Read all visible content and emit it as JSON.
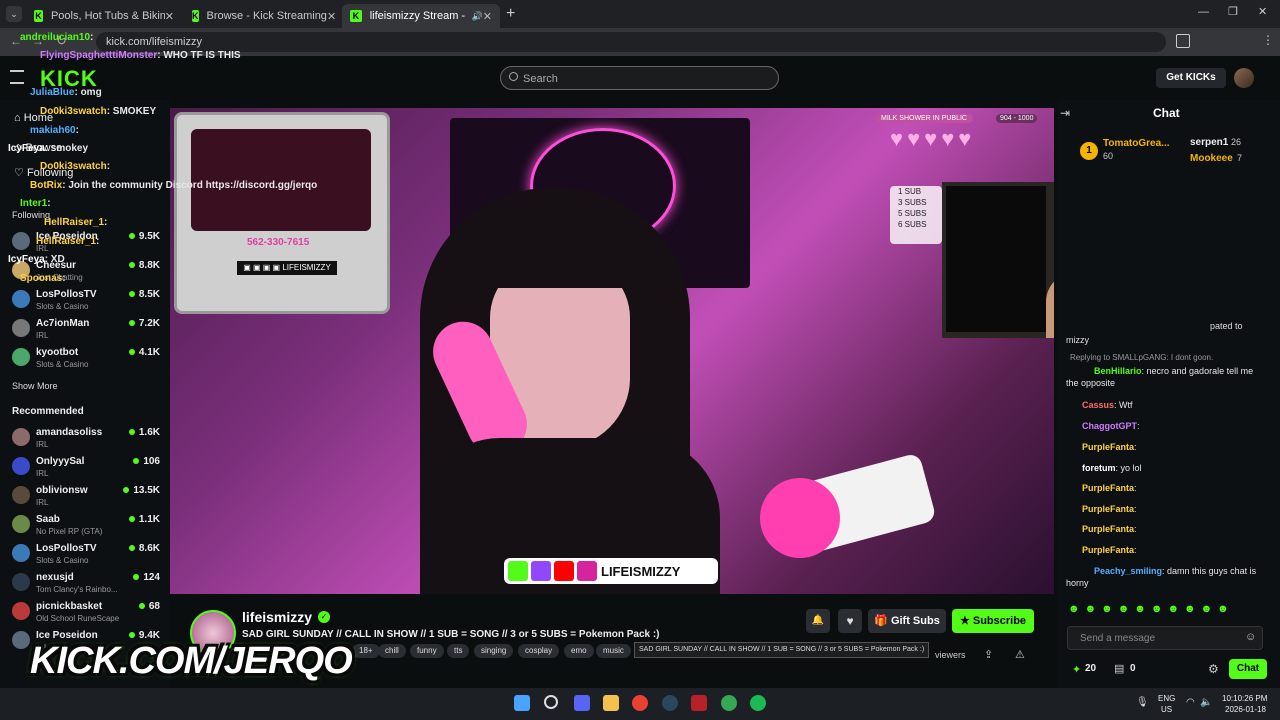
{
  "browser": {
    "tabs": [
      {
        "title": "Pools, Hot Tubs & Bikinis Strea",
        "active": false
      },
      {
        "title": "Browse - Kick Streaming",
        "active": false
      },
      {
        "title": "lifeismizzy Stream - Watch",
        "active": true
      }
    ],
    "new_tab": "+",
    "url": "kick.com/lifeismizzy",
    "window_controls": [
      "—",
      "❐",
      "✕"
    ]
  },
  "header": {
    "search_placeholder": "Search",
    "get_kicks_label": "Get KICKs"
  },
  "sidebar": {
    "nav": [
      {
        "label": "Home"
      },
      {
        "label": "Browse"
      },
      {
        "label": "Following"
      }
    ],
    "following_heading": "Following",
    "following": [
      {
        "name": "Ice Poseidon",
        "category": "IRL",
        "viewers": "9.5K"
      },
      {
        "name": "Cheesur",
        "category": "Just Chatting",
        "viewers": "8.8K"
      },
      {
        "name": "LosPollosTV",
        "category": "Slots & Casino",
        "viewers": "8.5K"
      },
      {
        "name": "Ac7ionMan",
        "category": "IRL",
        "viewers": "7.2K"
      },
      {
        "name": "kyootbot",
        "category": "Slots & Casino",
        "viewers": "4.1K"
      }
    ],
    "show_more": "Show More",
    "recommended_heading": "Recommended",
    "recommended": [
      {
        "name": "amandasoliss",
        "category": "IRL",
        "viewers": "1.6K"
      },
      {
        "name": "OnlyyySal",
        "category": "IRL",
        "viewers": "106"
      },
      {
        "name": "oblivionsw",
        "category": "IRL",
        "viewers": "13.5K"
      },
      {
        "name": "Saab",
        "category": "No Pixel RP (GTA)",
        "viewers": "1.1K"
      },
      {
        "name": "LosPollosTV",
        "category": "Slots & Casino",
        "viewers": "8.6K"
      },
      {
        "name": "nexusjd",
        "category": "Tom Clancy's Rainbo...",
        "viewers": "124"
      },
      {
        "name": "picnickbasket",
        "category": "Old School RuneScape",
        "viewers": "68"
      },
      {
        "name": "Ice Poseidon",
        "category": "IRL",
        "viewers": "9.4K"
      }
    ]
  },
  "overlay_chat": [
    {
      "user": "andreilucian10",
      "text": ":",
      "color": "#53fc18"
    },
    {
      "user": "FlyingSpaghetttiMonster",
      "text": ": WHO TF IS THIS",
      "color": "#d07cff"
    },
    {
      "user": "JuliaBlue",
      "text": ": omg",
      "color": "#53b0ff"
    },
    {
      "user": "Do0ki3swatch",
      "text": ": SMOKEY",
      "color": "#ffd23f"
    },
    {
      "user": "makiah60",
      "text": ":",
      "color": "#53b0ff"
    },
    {
      "user": "IcyFeya",
      "text": ": smokey",
      "color": "#ffffff"
    },
    {
      "user": "Do0ki3swatch",
      "text": ":",
      "color": "#ffd23f"
    },
    {
      "user": "BotRix",
      "text": ": Join the community Discord https://discord.gg/jerqo",
      "color": "#ffd23f"
    },
    {
      "user": "Inter1",
      "text": ":",
      "color": "#53fc18"
    },
    {
      "user": "HellRaiser_1",
      "text": ":",
      "color": "#ffd23f"
    },
    {
      "user": "HellRaiser_1",
      "text": ":",
      "color": "#ffd23f"
    },
    {
      "user": "IcyFeya",
      "text": ": XD",
      "color": "#ffffff"
    },
    {
      "user": "Spoonas",
      "text": ":",
      "color": "#ffd23f"
    }
  ],
  "stream": {
    "overlay_handle": "LIFEISMIZZY",
    "overlay_phone": "562-330-7615",
    "milk_shower_label": "MILK SHOWER IN PUBLIC",
    "milk_counter": "904 - 1000",
    "subs_list": [
      "1 SUB",
      "3 SUBS",
      "5 SUBS",
      "6 SUBS"
    ]
  },
  "channel": {
    "name": "lifeismizzy",
    "title": "SAD GIRL SUNDAY // CALL IN SHOW // 1 SUB = SONG // 3 or 5 SUBS = Pokemon Pack :)",
    "tooltip": "SAD GIRL SUNDAY // CALL IN SHOW // 1 SUB = SONG // 3 or 5 SUBS = Pokemon Pack :)",
    "tags": [
      "18+",
      "chill",
      "funny",
      "tts",
      "singing",
      "cosplay",
      "emo",
      "music"
    ],
    "gift_subs_label": "Gift Subs",
    "subscribe_label": "Subscribe",
    "viewers_label": "viewers"
  },
  "watermark": "KICK.COM/JERQO",
  "chat": {
    "title": "Chat",
    "leaderboard": [
      {
        "rank": "1",
        "name": "TomatoGrea...",
        "value": "60"
      },
      {
        "name": "serpen1",
        "value": "26"
      },
      {
        "name": "Mookeee",
        "value": "7"
      }
    ],
    "partial_lines": [
      "pated to",
      "mizzy"
    ],
    "reply_label": "Replying to SMALLpGANG: I dont goon.",
    "messages": [
      {
        "user": "BenHillario",
        "text": ": necro and gadorale tell me the opposite",
        "color": "#53fc18"
      },
      {
        "user": "Cassus",
        "text": ": Wtf",
        "color": "#ff6b6b"
      },
      {
        "user": "ChaggotGPT",
        "text": ":",
        "color": "#d07cff"
      },
      {
        "user": "PurpleFanta",
        "text": ":",
        "color": "#ffd23f"
      },
      {
        "user": "foretum",
        "text": ": yo lol",
        "color": "#ffffff"
      },
      {
        "user": "PurpleFanta",
        "text": ":",
        "color": "#ffd23f"
      },
      {
        "user": "PurpleFanta",
        "text": ":",
        "color": "#ffd23f"
      },
      {
        "user": "PurpleFanta",
        "text": ":",
        "color": "#ffd23f"
      },
      {
        "user": "PurpleFanta",
        "text": ":",
        "color": "#ffd23f"
      },
      {
        "user": "Peachy_smiling",
        "text": ": damn this guys chat is horny",
        "color": "#53b0ff"
      }
    ],
    "input_placeholder": "Send a message",
    "points": "20",
    "rewards": "0",
    "send_label": "Chat"
  },
  "taskbar": {
    "language": "ENG",
    "region": "US",
    "time": "10:10:26 PM",
    "date": "2026-01-18"
  },
  "colors": {
    "kick_green": "#53fc18",
    "bg": "#0b0e0f",
    "panel": "#0d1012"
  }
}
